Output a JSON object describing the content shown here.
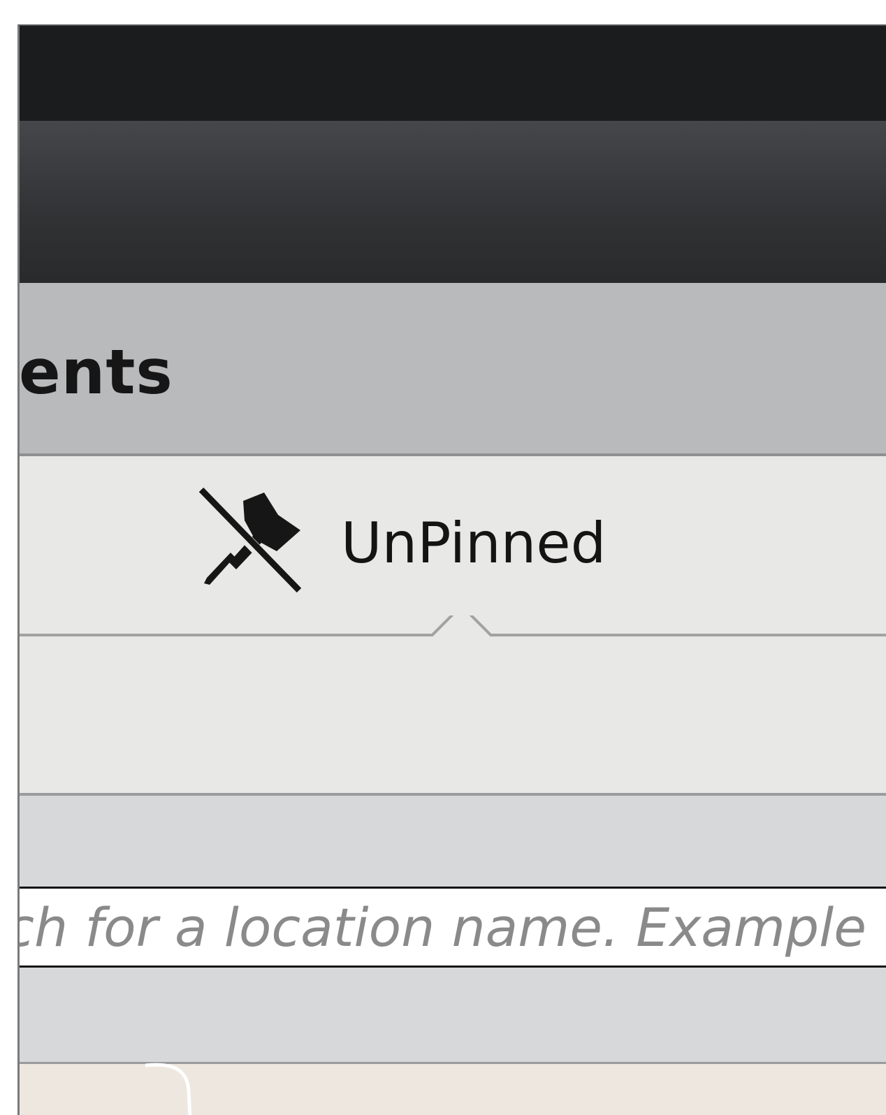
{
  "header": {
    "title": "ents"
  },
  "pin_toggle": {
    "label": "UnPinned",
    "icon": "unpin-icon"
  },
  "search": {
    "placeholder": "rch for a location name. Example ..."
  },
  "colors": {
    "titlebar": "#1b1c1e",
    "toolbar": "#3a3c3f",
    "header": "#b9babb",
    "panel": "#e8e8e6",
    "search_area": "#d7d8da",
    "map": "#ede7df"
  }
}
